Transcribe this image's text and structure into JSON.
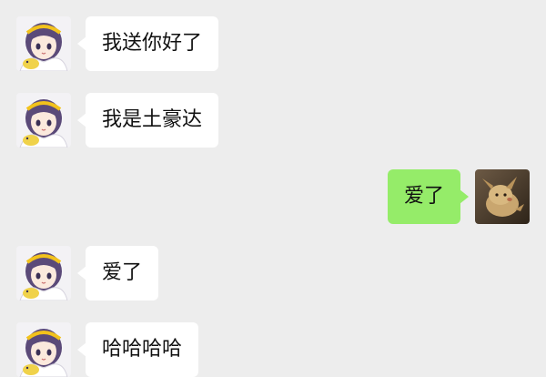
{
  "messages": [
    {
      "side": "left",
      "text": "我送你好了",
      "avatar_icon": "anime-girl-avatar-icon"
    },
    {
      "side": "left",
      "text": "我是土豪达",
      "avatar_icon": "anime-girl-avatar-icon"
    },
    {
      "side": "right",
      "text": "爱了",
      "avatar_icon": "pikachu-avatar-icon"
    },
    {
      "side": "left",
      "text": "爱了",
      "avatar_icon": "anime-girl-avatar-icon"
    },
    {
      "side": "left",
      "text": "哈哈哈哈",
      "avatar_icon": "anime-girl-avatar-icon"
    }
  ],
  "colors": {
    "background": "#ededed",
    "incoming_bubble": "#ffffff",
    "outgoing_bubble": "#95ec69"
  }
}
